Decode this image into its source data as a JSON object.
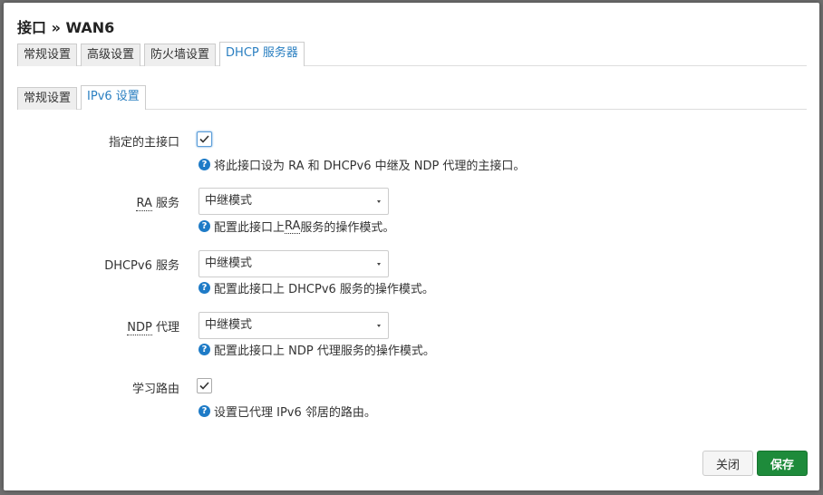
{
  "title": "接口 » WAN6",
  "main_tabs": [
    {
      "label": "常规设置",
      "active": false
    },
    {
      "label": "高级设置",
      "active": false
    },
    {
      "label": "防火墙设置",
      "active": false
    },
    {
      "label": "DHCP 服务器",
      "active": true
    }
  ],
  "sub_tabs": [
    {
      "label": "常规设置",
      "active": false
    },
    {
      "label": "IPv6 设置",
      "active": true
    }
  ],
  "fields": {
    "master": {
      "label": "指定的主接口",
      "checked": true,
      "help": "将此接口设为 RA 和 DHCPv6 中继及 NDP 代理的主接口。"
    },
    "ra": {
      "label_abbr": "RA",
      "label_rest": " 服务",
      "value": "中继模式",
      "help_pre": "配置此接口上 ",
      "help_abbr": "RA",
      "help_post": " 服务的操作模式。"
    },
    "dhcpv6": {
      "label": "DHCPv6 服务",
      "value": "中继模式",
      "help": "配置此接口上 DHCPv6 服务的操作模式。"
    },
    "ndp": {
      "label_abbr": "NDP",
      "label_rest": " 代理",
      "value": "中继模式",
      "help": "配置此接口上 NDP 代理服务的操作模式。"
    },
    "learn_routes": {
      "label": "学习路由",
      "checked": true,
      "help": "设置已代理 IPv6 邻居的路由。"
    }
  },
  "buttons": {
    "close": "关闭",
    "save": "保存"
  },
  "colors": {
    "accent": "#2a7fc1",
    "save": "#1e8b3b",
    "help_icon": "#1e7bc7"
  }
}
